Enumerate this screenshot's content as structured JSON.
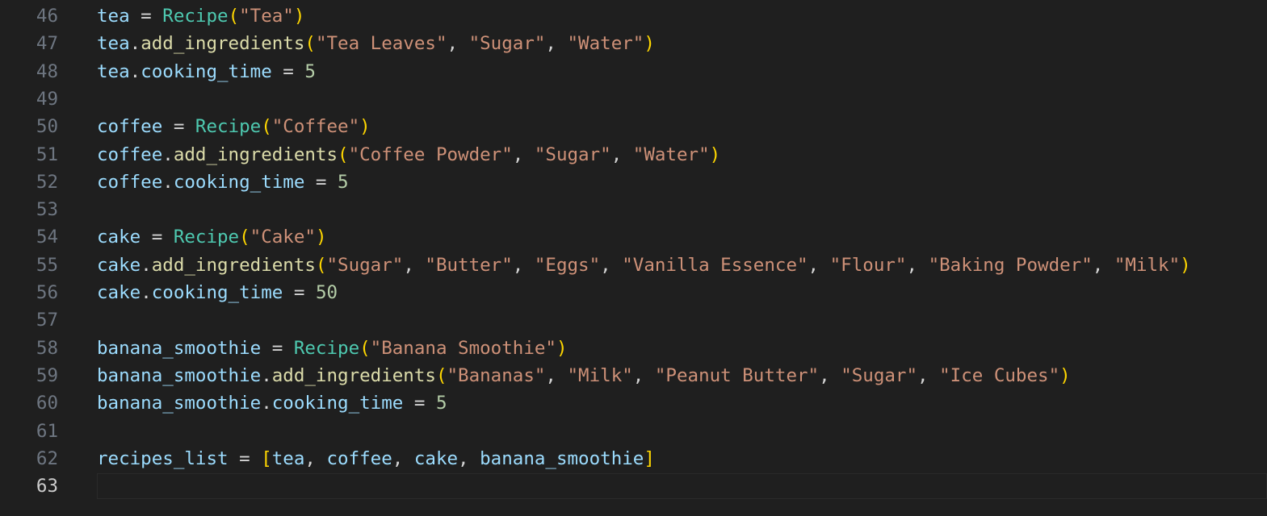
{
  "editor": {
    "lines": [
      {
        "number": "46",
        "tokens": [
          {
            "t": "tea",
            "c": "var"
          },
          {
            "t": " = ",
            "c": "op"
          },
          {
            "t": "Recipe",
            "c": "cls"
          },
          {
            "t": "(",
            "c": "p1"
          },
          {
            "t": "\"Tea\"",
            "c": "str"
          },
          {
            "t": ")",
            "c": "p1"
          }
        ]
      },
      {
        "number": "47",
        "tokens": [
          {
            "t": "tea",
            "c": "var"
          },
          {
            "t": ".",
            "c": "op"
          },
          {
            "t": "add_ingredients",
            "c": "fn"
          },
          {
            "t": "(",
            "c": "p1"
          },
          {
            "t": "\"Tea Leaves\"",
            "c": "str"
          },
          {
            "t": ", ",
            "c": "op"
          },
          {
            "t": "\"Sugar\"",
            "c": "str"
          },
          {
            "t": ", ",
            "c": "op"
          },
          {
            "t": "\"Water\"",
            "c": "str"
          },
          {
            "t": ")",
            "c": "p1"
          }
        ]
      },
      {
        "number": "48",
        "tokens": [
          {
            "t": "tea",
            "c": "var"
          },
          {
            "t": ".",
            "c": "op"
          },
          {
            "t": "cooking_time",
            "c": "var"
          },
          {
            "t": " = ",
            "c": "op"
          },
          {
            "t": "5",
            "c": "num"
          }
        ]
      },
      {
        "number": "49",
        "tokens": []
      },
      {
        "number": "50",
        "tokens": [
          {
            "t": "coffee",
            "c": "var"
          },
          {
            "t": " = ",
            "c": "op"
          },
          {
            "t": "Recipe",
            "c": "cls"
          },
          {
            "t": "(",
            "c": "p1"
          },
          {
            "t": "\"Coffee\"",
            "c": "str"
          },
          {
            "t": ")",
            "c": "p1"
          }
        ]
      },
      {
        "number": "51",
        "tokens": [
          {
            "t": "coffee",
            "c": "var"
          },
          {
            "t": ".",
            "c": "op"
          },
          {
            "t": "add_ingredients",
            "c": "fn"
          },
          {
            "t": "(",
            "c": "p1"
          },
          {
            "t": "\"Coffee Powder\"",
            "c": "str"
          },
          {
            "t": ", ",
            "c": "op"
          },
          {
            "t": "\"Sugar\"",
            "c": "str"
          },
          {
            "t": ", ",
            "c": "op"
          },
          {
            "t": "\"Water\"",
            "c": "str"
          },
          {
            "t": ")",
            "c": "p1"
          }
        ]
      },
      {
        "number": "52",
        "tokens": [
          {
            "t": "coffee",
            "c": "var"
          },
          {
            "t": ".",
            "c": "op"
          },
          {
            "t": "cooking_time",
            "c": "var"
          },
          {
            "t": " = ",
            "c": "op"
          },
          {
            "t": "5",
            "c": "num"
          }
        ]
      },
      {
        "number": "53",
        "tokens": []
      },
      {
        "number": "54",
        "tokens": [
          {
            "t": "cake",
            "c": "var"
          },
          {
            "t": " = ",
            "c": "op"
          },
          {
            "t": "Recipe",
            "c": "cls"
          },
          {
            "t": "(",
            "c": "p1"
          },
          {
            "t": "\"Cake\"",
            "c": "str"
          },
          {
            "t": ")",
            "c": "p1"
          }
        ]
      },
      {
        "number": "55",
        "tokens": [
          {
            "t": "cake",
            "c": "var"
          },
          {
            "t": ".",
            "c": "op"
          },
          {
            "t": "add_ingredients",
            "c": "fn"
          },
          {
            "t": "(",
            "c": "p1"
          },
          {
            "t": "\"Sugar\"",
            "c": "str"
          },
          {
            "t": ", ",
            "c": "op"
          },
          {
            "t": "\"Butter\"",
            "c": "str"
          },
          {
            "t": ", ",
            "c": "op"
          },
          {
            "t": "\"Eggs\"",
            "c": "str"
          },
          {
            "t": ", ",
            "c": "op"
          },
          {
            "t": "\"Vanilla Essence\"",
            "c": "str"
          },
          {
            "t": ", ",
            "c": "op"
          },
          {
            "t": "\"Flour\"",
            "c": "str"
          },
          {
            "t": ", ",
            "c": "op"
          },
          {
            "t": "\"Baking Powder\"",
            "c": "str"
          },
          {
            "t": ", ",
            "c": "op"
          },
          {
            "t": "\"Milk\"",
            "c": "str"
          },
          {
            "t": ")",
            "c": "p1"
          }
        ]
      },
      {
        "number": "56",
        "tokens": [
          {
            "t": "cake",
            "c": "var"
          },
          {
            "t": ".",
            "c": "op"
          },
          {
            "t": "cooking_time",
            "c": "var"
          },
          {
            "t": " = ",
            "c": "op"
          },
          {
            "t": "50",
            "c": "num"
          }
        ]
      },
      {
        "number": "57",
        "tokens": []
      },
      {
        "number": "58",
        "tokens": [
          {
            "t": "banana_smoothie",
            "c": "var"
          },
          {
            "t": " = ",
            "c": "op"
          },
          {
            "t": "Recipe",
            "c": "cls"
          },
          {
            "t": "(",
            "c": "p1"
          },
          {
            "t": "\"Banana Smoothie\"",
            "c": "str"
          },
          {
            "t": ")",
            "c": "p1"
          }
        ]
      },
      {
        "number": "59",
        "tokens": [
          {
            "t": "banana_smoothie",
            "c": "var"
          },
          {
            "t": ".",
            "c": "op"
          },
          {
            "t": "add_ingredients",
            "c": "fn"
          },
          {
            "t": "(",
            "c": "p1"
          },
          {
            "t": "\"Bananas\"",
            "c": "str"
          },
          {
            "t": ", ",
            "c": "op"
          },
          {
            "t": "\"Milk\"",
            "c": "str"
          },
          {
            "t": ", ",
            "c": "op"
          },
          {
            "t": "\"Peanut Butter\"",
            "c": "str"
          },
          {
            "t": ", ",
            "c": "op"
          },
          {
            "t": "\"Sugar\"",
            "c": "str"
          },
          {
            "t": ", ",
            "c": "op"
          },
          {
            "t": "\"Ice Cubes\"",
            "c": "str"
          },
          {
            "t": ")",
            "c": "p1"
          }
        ]
      },
      {
        "number": "60",
        "tokens": [
          {
            "t": "banana_smoothie",
            "c": "var"
          },
          {
            "t": ".",
            "c": "op"
          },
          {
            "t": "cooking_time",
            "c": "var"
          },
          {
            "t": " = ",
            "c": "op"
          },
          {
            "t": "5",
            "c": "num"
          }
        ]
      },
      {
        "number": "61",
        "tokens": []
      },
      {
        "number": "62",
        "tokens": [
          {
            "t": "recipes_list",
            "c": "var"
          },
          {
            "t": " = ",
            "c": "op"
          },
          {
            "t": "[",
            "c": "p1"
          },
          {
            "t": "tea",
            "c": "var"
          },
          {
            "t": ", ",
            "c": "op"
          },
          {
            "t": "coffee",
            "c": "var"
          },
          {
            "t": ", ",
            "c": "op"
          },
          {
            "t": "cake",
            "c": "var"
          },
          {
            "t": ", ",
            "c": "op"
          },
          {
            "t": "banana_smoothie",
            "c": "var"
          },
          {
            "t": "]",
            "c": "p1"
          }
        ]
      },
      {
        "number": "63",
        "tokens": [],
        "current": true
      }
    ]
  }
}
